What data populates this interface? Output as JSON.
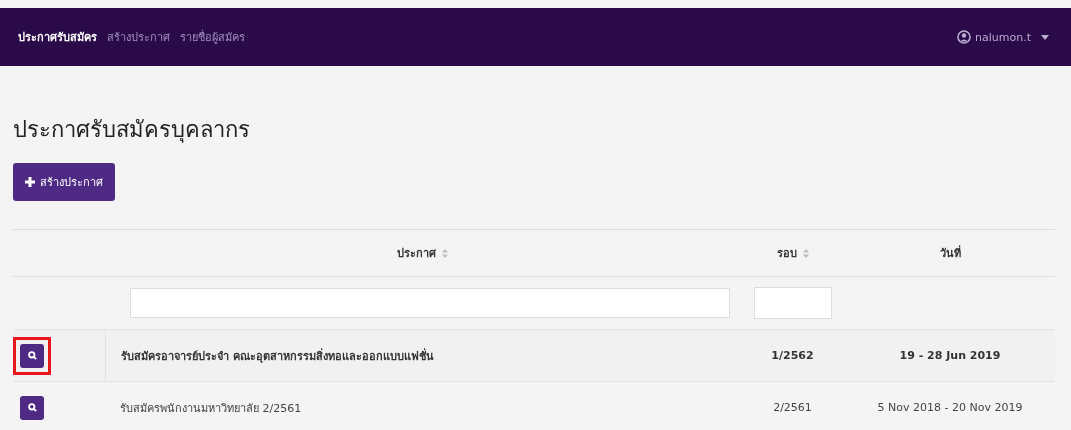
{
  "navbar": {
    "items": [
      {
        "label": "ประกาศรับสมัคร",
        "selected": true
      },
      {
        "label": "สร้างประกาศ",
        "selected": false
      },
      {
        "label": "รายชื่อผู้สมัคร",
        "selected": false
      }
    ],
    "user": "nalumon.t"
  },
  "heading": "ประกาศรับสมัครบุคลากร",
  "create_button": "สร้างประกาศ",
  "table": {
    "columns": [
      {
        "label": "ประกาศ",
        "sortable": true
      },
      {
        "label": "รอบ",
        "sortable": true
      },
      {
        "label": "วันที่",
        "sortable": false
      }
    ],
    "rows": [
      {
        "title": "รับสมัครอาจารย์ประจำ คณะอุตสาหกรรมสิ่งทอและออกแบบแฟชั่น",
        "round": "1/2562",
        "dates": "19 - 28 Jun 2019",
        "bold": true,
        "annotated": true
      },
      {
        "title": "รับสมัครพนักงานมหาวิทยาลัย 2/2561",
        "round": "2/2561",
        "dates": "5 Nov 2018 - 20 Nov 2019",
        "bold": false,
        "annotated": false
      }
    ]
  }
}
